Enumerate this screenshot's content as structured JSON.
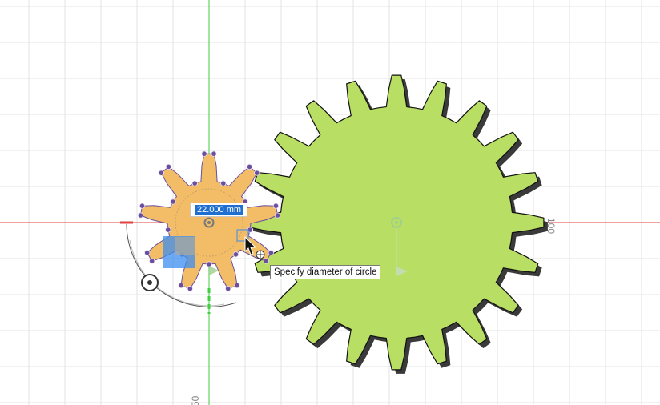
{
  "viewport": {
    "axis_labels": {
      "x_tick": "100",
      "y_tick": "50"
    },
    "dimension_input": {
      "value": "22.000 mm"
    },
    "tooltip": {
      "text": "Specify diameter of circle"
    },
    "colors": {
      "grid": "#e3e3e3",
      "x_axis": "#e04040",
      "y_axis": "#3fcf3f",
      "large_gear_fill": "#b8de64",
      "small_gear_fill": "#f2bd66",
      "constraint_point": "#6a4f9e",
      "selection": "#3c8df0"
    },
    "large_gear": {
      "teeth": 20
    },
    "small_gear": {
      "teeth": 9
    }
  }
}
